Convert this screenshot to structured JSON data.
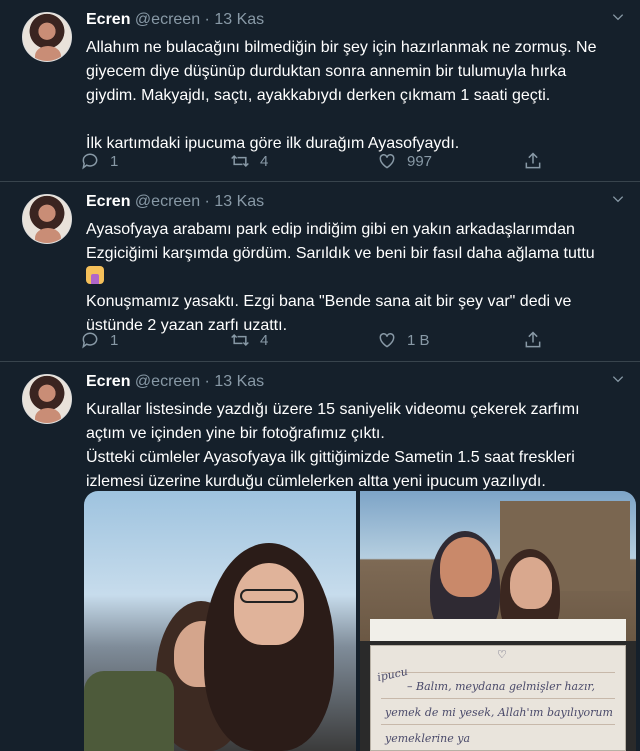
{
  "tweets": [
    {
      "name": "Ecren",
      "handle": "@ecreen",
      "dot": "·",
      "date": "13 Kas",
      "text": "Allahım ne bulacağını bilmediğin bir şey için hazırlanmak ne zormuş. Ne giyecem diye düşünüp durduktan sonra annemin bir tulumuyla hırka giydim. Makyajdı, saçtı, ayakkabıydı derken çıkmam 1 saati geçti.\n\nİlk kartımdaki ipucuma göre ilk durağım Ayasofyaydı.",
      "replies": "1",
      "retweets": "4",
      "likes": "997"
    },
    {
      "name": "Ecren",
      "handle": "@ecreen",
      "dot": "·",
      "date": "13 Kas",
      "text_a": "Ayasofyaya arabamı park edip indiğim gibi en yakın arkadaşlarımdan Ezgiciğimi karşımda gördüm. Sarıldık ve beni bir fasıl daha ağlama tuttu",
      "text_b": "Konuşmamız yasaktı. Ezgi bana \"Bende sana ait bir şey var\" dedi ve üstünde 2 yazan zarfı uzattı.",
      "replies": "1",
      "retweets": "4",
      "likes": "1 B"
    },
    {
      "name": "Ecren",
      "handle": "@ecreen",
      "dot": "·",
      "date": "13 Kas",
      "text": "Kurallar listesinde yazdığı üzere 15 saniyelik videomu çekerek zarfımı açtım ve içinden yine bir fotoğrafımız çıktı.\nÜstteki cümleler Ayasofyaya ilk gittiğimizde Sametin 1.5 saat freskleri izlemesi üzerine kurduğu cümlelerken altta yeni ipucum yazılıydı.",
      "card_lines": [
        "ipucu",
        "– Balım, meydana gelmişler hazır,",
        "yemek de mi yesek, Allah'ım bayılıyorum",
        "yemeklerine ya"
      ]
    }
  ],
  "icons": {
    "reply": "reply-icon",
    "retweet": "retweet-icon",
    "like": "heart-icon",
    "share": "share-icon",
    "more": "chevron-down-icon"
  },
  "colors": {
    "background": "#15202b",
    "secondary_text": "#8899a6",
    "divider": "#38444d"
  }
}
